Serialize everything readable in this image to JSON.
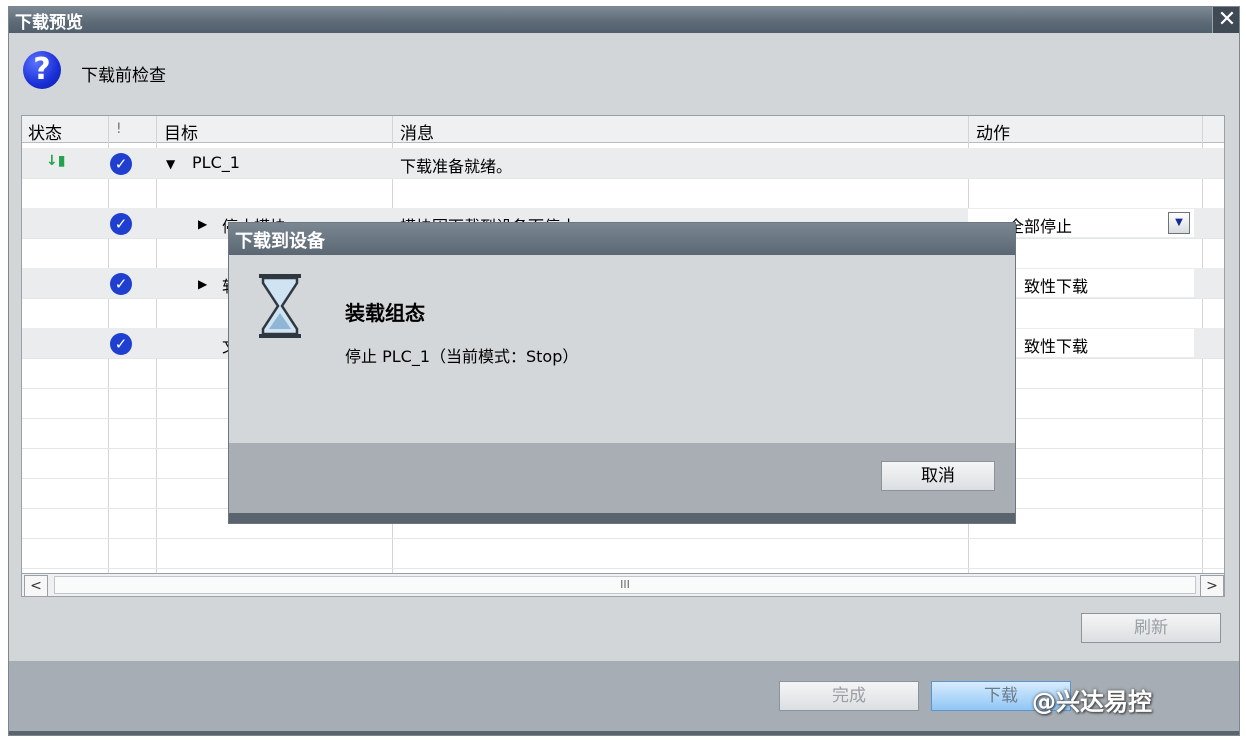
{
  "window": {
    "title": "下载预览",
    "close_glyph": "✕"
  },
  "header": {
    "text": "下载前检查",
    "icon": "question-icon"
  },
  "columns": [
    "状态",
    "!",
    "目标",
    "消息",
    "动作"
  ],
  "rows": [
    {
      "target": "PLC_1",
      "message": "下载准备就绪。",
      "action": ""
    },
    {
      "target": "停止模块",
      "message": "模块因下载到设备而停止。",
      "action": "全部停止"
    },
    {
      "target": "软",
      "message": "",
      "action": "致性下载"
    },
    {
      "target": "文",
      "message": "",
      "action": "致性下载"
    }
  ],
  "scroll": {
    "left": "<",
    "right": ">",
    "thumb": "III"
  },
  "buttons": {
    "refresh": "刷新",
    "finish": "完成",
    "download": "下载"
  },
  "dialog": {
    "title": "下载到设备",
    "heading": "装载组态",
    "message": "停止 PLC_1（当前模式：Stop）",
    "cancel": "取消",
    "icon": "hourglass-icon"
  },
  "watermark": "@兴达易控",
  "colors": {
    "title_bar": "#5c6976",
    "check": "#1f3fd0",
    "status_arrow": "#23a14b"
  }
}
